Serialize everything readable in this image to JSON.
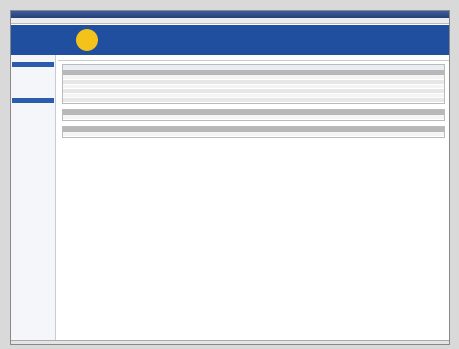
{
  "window": {
    "title": "",
    "menu": [
      "",
      "",
      "",
      "",
      ""
    ]
  },
  "banner": {
    "product": "",
    "brand": "",
    "brand_sub": "",
    "tiny": ""
  },
  "sidebar": {
    "items": [
      {
        "label": "",
        "active": false
      },
      {
        "label": "",
        "active": true
      },
      {
        "label": "",
        "active": false
      },
      {
        "label": "",
        "active": false
      },
      {
        "label": "",
        "active": false
      },
      {
        "label": "",
        "active": false
      },
      {
        "label": "",
        "active": false
      },
      {
        "label": "",
        "active": true
      }
    ]
  },
  "main": {
    "breadcrumb": "",
    "info_line": "",
    "links": [
      "",
      "",
      "",
      ""
    ],
    "table1": {
      "title": "",
      "headers": [
        "",
        "",
        "",
        "",
        "",
        "",
        "",
        "",
        "",
        ""
      ],
      "rows": [
        [
          "",
          "",
          "",
          "",
          "",
          "",
          "",
          "",
          "",
          ""
        ],
        [
          "",
          "",
          "",
          "",
          "",
          "",
          "",
          "",
          "",
          ""
        ],
        [
          "",
          "",
          "",
          "",
          "",
          "",
          "",
          "",
          "",
          ""
        ],
        [
          "",
          "",
          "",
          "",
          "",
          "",
          "",
          "",
          "",
          ""
        ],
        [
          "",
          "",
          "",
          "",
          "",
          "",
          "",
          "",
          "",
          ""
        ],
        [
          "",
          "",
          "",
          "",
          "",
          "",
          "",
          "",
          "",
          ""
        ]
      ]
    },
    "section2": {
      "heading": "",
      "subheading": "",
      "headers": [
        "",
        "",
        "",
        "",
        "",
        "",
        "",
        ""
      ],
      "rows": [
        [
          "",
          "",
          "",
          "",
          "",
          "",
          "",
          ""
        ]
      ]
    },
    "section3": {
      "heading": "",
      "subheading": "",
      "headers": [
        "",
        "",
        "",
        "",
        ""
      ],
      "rows": [
        [
          "",
          "",
          "",
          "",
          ""
        ]
      ]
    },
    "footer_link": ""
  },
  "colors": {
    "banner": "#1f4f9e",
    "sun": "#f3c21b",
    "table_header": "#b8b8b8",
    "sidebar_active": "#2b5cae"
  }
}
